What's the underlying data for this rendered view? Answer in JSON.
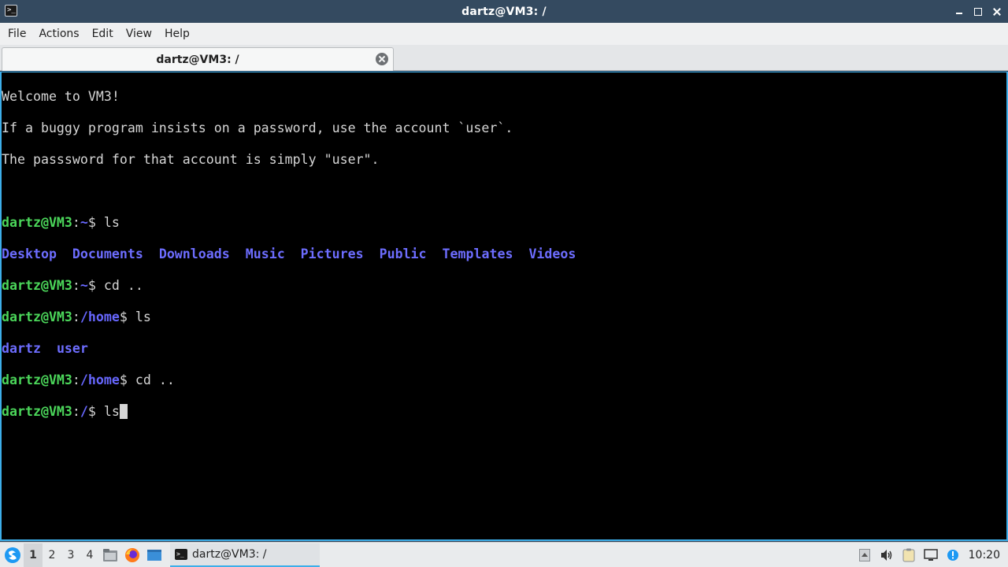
{
  "window": {
    "title": "dartz@VM3: /"
  },
  "menu": [
    "File",
    "Actions",
    "Edit",
    "View",
    "Help"
  ],
  "tab": {
    "label": "dartz@VM3: /"
  },
  "terminal": {
    "motd": [
      "Welcome to VM3!",
      "If a buggy program insists on a password, use the account `user`.",
      "The passsword for that account is simply \"user\"."
    ],
    "prompt_user": "dartz@VM3",
    "sessions": [
      {
        "path": "~",
        "cmd": "ls"
      },
      {
        "path": "~",
        "cmd": "cd .."
      },
      {
        "path": "/home",
        "cmd": "ls"
      },
      {
        "path": "/home",
        "cmd": "cd .."
      },
      {
        "path": "/",
        "cmd": "ls"
      }
    ],
    "home_listing": [
      "Desktop",
      "Documents",
      "Downloads",
      "Music",
      "Pictures",
      "Public",
      "Templates",
      "Videos"
    ],
    "homes_listing": [
      "dartz",
      "user"
    ]
  },
  "taskbar": {
    "desktops": [
      "1",
      "2",
      "3",
      "4"
    ],
    "active_desktop": "1",
    "task_label": "dartz@VM3: /",
    "clock": "10:20",
    "icons": [
      "start-menu-icon",
      "file-manager-icon",
      "firefox-icon",
      "show-desktop-icon",
      "tray-arrow-icon",
      "volume-icon",
      "clipboard-icon",
      "network-icon",
      "notification-icon"
    ]
  },
  "colors": {
    "prompt_user": "#4bd65a",
    "prompt_path": "#6767ff",
    "directory": "#6d6dff",
    "accent": "#3daee9"
  }
}
